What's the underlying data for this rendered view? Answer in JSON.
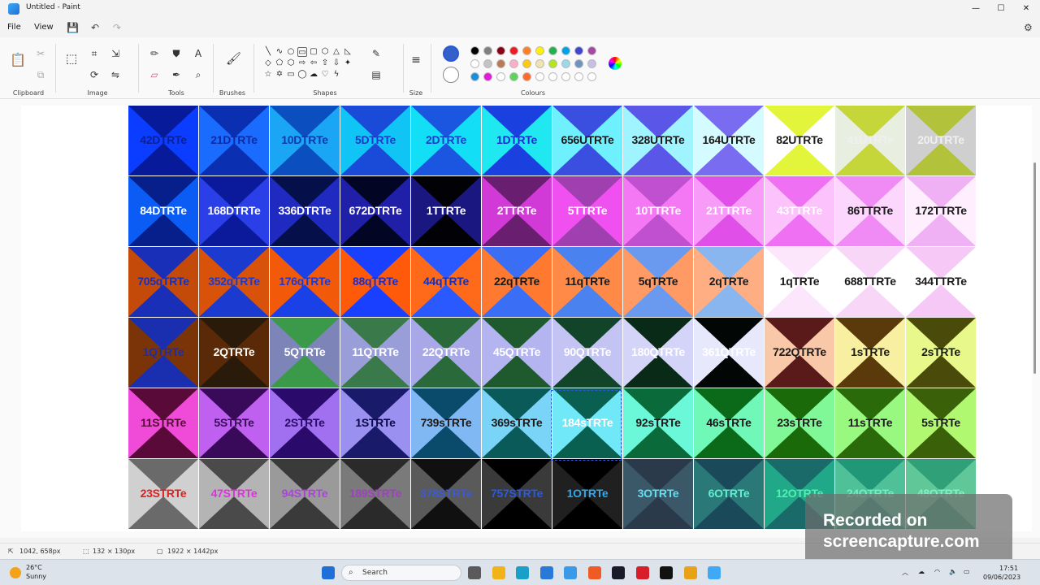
{
  "window": {
    "title": "Untitled - Paint",
    "minimize_glyph": "—",
    "maximize_glyph": "☐",
    "close_glyph": "✕"
  },
  "menu": {
    "file": "File",
    "view": "View"
  },
  "ribbon": {
    "groups": [
      "Clipboard",
      "Image",
      "Tools",
      "Brushes",
      "Shapes",
      "Size",
      "Colours"
    ],
    "primary_color": "#3461c9",
    "secondary_color": "#ffffff",
    "palette_row1": [
      "#000000",
      "#7f7f7f",
      "#880015",
      "#ed1c24",
      "#ff7f27",
      "#fff200",
      "#22b14c",
      "#00a2e8",
      "#3f48cc",
      "#a349a4"
    ],
    "palette_row2": [
      "#ffffff",
      "#c3c3c3",
      "#b97a57",
      "#ffaec9",
      "#ffc90e",
      "#efe4b0",
      "#b5e61d",
      "#99d9ea",
      "#7092be",
      "#c8bfe7"
    ],
    "palette_row3": [
      "#1a8fd8",
      "#e31ad8",
      "#ffffff",
      "#5cd45c",
      "#ff6a2a",
      "#ffffff",
      "#ffffff",
      "#ffffff",
      "#ffffff",
      "#ffffff"
    ]
  },
  "canvas": {
    "rows": [
      [
        {
          "label": "42DTRTe",
          "bg": "#0a3dff",
          "dark": "#061a9a",
          "text": "#0a1f9a"
        },
        {
          "label": "21DTRTe",
          "bg": "#1a6cff",
          "dark": "#0a2fb0",
          "text": "#0b2aa8"
        },
        {
          "label": "10DTRTe",
          "bg": "#1aa6f5",
          "dark": "#0a4ec0",
          "text": "#0b3ab0"
        },
        {
          "label": "5DTRTe",
          "bg": "#10c4f5",
          "dark": "#1a4ad8",
          "text": "#1a3cc8"
        },
        {
          "label": "2DTRTe",
          "bg": "#12dff5",
          "dark": "#1a56e0",
          "text": "#1a3ad0"
        },
        {
          "label": "1DTRTe",
          "bg": "#20e8f0",
          "dark": "#1a40e0",
          "text": "#1a2fd0"
        },
        {
          "label": "656UTRTe",
          "bg": "#6ff0ff",
          "dark": "#3a4ee0",
          "text": "#1a1a1a"
        },
        {
          "label": "328UTRTe",
          "bg": "#a0f4ff",
          "dark": "#5a56e8",
          "text": "#1a1a1a"
        },
        {
          "label": "164UTRTe",
          "bg": "#d4fbff",
          "dark": "#7a6cf0",
          "text": "#1a1a1a"
        },
        {
          "label": "82UTRTe",
          "bg": "#ffffff",
          "dark": "#e2f53a",
          "text": "#1a1a1a"
        },
        {
          "label": "41UTRTe",
          "bg": "#e8eee0",
          "dark": "#c4d63a",
          "text": "#f0f0f0"
        },
        {
          "label": "20UTRTe",
          "bg": "#cfcfcf",
          "dark": "#b2c23a",
          "text": "#f0f0f0"
        }
      ],
      [
        {
          "label": "84DTRTe",
          "bg": "#0a5cf5",
          "dark": "#061f8a",
          "text": "#ffffff"
        },
        {
          "label": "168DTRTe",
          "bg": "#2a3fe8",
          "dark": "#0a1a9a",
          "text": "#ffffff"
        },
        {
          "label": "336DTRTe",
          "bg": "#1f2ac0",
          "dark": "#05104a",
          "text": "#ffffff"
        },
        {
          "label": "672DTRTe",
          "bg": "#1f1fa8",
          "dark": "#020524",
          "text": "#ffffff"
        },
        {
          "label": "1TTRTe",
          "bg": "#1a1880",
          "dark": "#010106",
          "text": "#ffffff"
        },
        {
          "label": "2TTRTe",
          "bg": "#d23ad8",
          "dark": "#6a1e70",
          "text": "#ffffff"
        },
        {
          "label": "5TTRTe",
          "bg": "#f050f0",
          "dark": "#a040b0",
          "text": "#ffffff"
        },
        {
          "label": "10TTRTe",
          "bg": "#f478f4",
          "dark": "#c050d0",
          "text": "#ffffff"
        },
        {
          "label": "21TTRTe",
          "bg": "#f89af8",
          "dark": "#e050e8",
          "text": "#ffffff"
        },
        {
          "label": "43TTRTe",
          "bg": "#fbc2fb",
          "dark": "#f070f4",
          "text": "#ffffff"
        },
        {
          "label": "86TTRTe",
          "bg": "#fcd6fc",
          "dark": "#f08af4",
          "text": "#1a1a1a"
        },
        {
          "label": "172TTRTe",
          "bg": "#feeefe",
          "dark": "#f0b0f4",
          "text": "#1a1a1a"
        }
      ],
      [
        {
          "label": "705qTRTe",
          "bg": "#c44a0a",
          "dark": "#1a2fb8",
          "text": "#1a2fb8"
        },
        {
          "label": "352qTRTe",
          "bg": "#d8520a",
          "dark": "#1a3ad0",
          "text": "#1a3ad0"
        },
        {
          "label": "176qTRTe",
          "bg": "#f25a0a",
          "dark": "#1a40e8",
          "text": "#1a3ad8"
        },
        {
          "label": "88qTRTe",
          "bg": "#ff5a0a",
          "dark": "#1a40ff",
          "text": "#1a2fc8"
        },
        {
          "label": "44qTRTe",
          "bg": "#ff6a1a",
          "dark": "#2a5aff",
          "text": "#1a2fb0"
        },
        {
          "label": "22qTRTe",
          "bg": "#ff7a30",
          "dark": "#3a6ef5",
          "text": "#1a1a1a"
        },
        {
          "label": "11qTRTe",
          "bg": "#ff8a48",
          "dark": "#4a82f0",
          "text": "#1a1a1a"
        },
        {
          "label": "5qTRTe",
          "bg": "#ff9a64",
          "dark": "#6a9af0",
          "text": "#1a1a1a"
        },
        {
          "label": "2qTRTe",
          "bg": "#ffae84",
          "dark": "#8ab6f0",
          "text": "#1a1a1a"
        },
        {
          "label": "1qTRTe",
          "bg": "#ffffff",
          "dark": "#fbe6fb",
          "text": "#1a1a1a"
        },
        {
          "label": "688TTRTe",
          "bg": "#ffffff",
          "dark": "#f8d6f8",
          "text": "#1a1a1a"
        },
        {
          "label": "344TTRTe",
          "bg": "#ffffff",
          "dark": "#f6c8f6",
          "text": "#1a1a1a"
        }
      ],
      [
        {
          "label": "1QTRTe",
          "bg": "#7a3408",
          "dark": "#1a2fb0",
          "text": "#1a2fb0"
        },
        {
          "label": "2QTRTe",
          "bg": "#5a2a08",
          "dark": "#2a1a0a",
          "text": "#ffffff"
        },
        {
          "label": "5QTRTe",
          "bg": "#7c84b8",
          "dark": "#3a9a4a",
          "text": "#ffffff"
        },
        {
          "label": "11QTRTe",
          "bg": "#9a9ed8",
          "dark": "#3a7a4a",
          "text": "#ffffff"
        },
        {
          "label": "22QTRTe",
          "bg": "#a8a8e8",
          "dark": "#2a6a3a",
          "text": "#ffffff"
        },
        {
          "label": "45QTRTe",
          "bg": "#b4b4f0",
          "dark": "#1f5a2f",
          "text": "#ffffff"
        },
        {
          "label": "90QTRTe",
          "bg": "#c4c4f4",
          "dark": "#12442a",
          "text": "#ffffff"
        },
        {
          "label": "180QTRTe",
          "bg": "#d4d4f8",
          "dark": "#0a2a18",
          "text": "#ffffff"
        },
        {
          "label": "361QTRTe",
          "bg": "#e8e8fc",
          "dark": "#020604",
          "text": "#ffffff"
        },
        {
          "label": "722QTRTe",
          "bg": "#f8c8a8",
          "dark": "#5a1a1a",
          "text": "#1a1a1a"
        },
        {
          "label": "1sTRTe",
          "bg": "#f8f0a0",
          "dark": "#5a3a0a",
          "text": "#1a1a1a"
        },
        {
          "label": "2sTRTe",
          "bg": "#e8f88a",
          "dark": "#4a4a0a",
          "text": "#1a1a1a"
        }
      ],
      [
        {
          "label": "11STRTe",
          "bg": "#f04ad8",
          "dark": "#5a0a38",
          "text": "#5a0a38"
        },
        {
          "label": "5STRTe",
          "bg": "#c060f0",
          "dark": "#3a0a5a",
          "text": "#3a0a5a"
        },
        {
          "label": "2STRTe",
          "bg": "#a070f0",
          "dark": "#2a0a6a",
          "text": "#2a0a6a"
        },
        {
          "label": "1STRTe",
          "bg": "#9a90f0",
          "dark": "#1a1a6a",
          "text": "#0a0a4a"
        },
        {
          "label": "739sTRTe",
          "bg": "#80b8f4",
          "dark": "#0a4a6a",
          "text": "#1a1a1a"
        },
        {
          "label": "369sTRTe",
          "bg": "#7ad4f8",
          "dark": "#0a5a5a",
          "text": "#1a1a1a"
        },
        {
          "label": "184sTRTe",
          "bg": "#70e8f8",
          "dark": "#0a6050",
          "text": "#ffffff"
        },
        {
          "label": "92sTRTe",
          "bg": "#6af8d8",
          "dark": "#0a6a3a",
          "text": "#1a1a1a"
        },
        {
          "label": "46sTRTe",
          "bg": "#70f8b8",
          "dark": "#0a6a1a",
          "text": "#1a1a1a"
        },
        {
          "label": "23sTRTe",
          "bg": "#80f898",
          "dark": "#1a6a0a",
          "text": "#1a1a1a"
        },
        {
          "label": "11sTRTe",
          "bg": "#98f880",
          "dark": "#2a6a0a",
          "text": "#1a1a1a"
        },
        {
          "label": "5sTRTe",
          "bg": "#b0f870",
          "dark": "#3a600a",
          "text": "#1a1a1a"
        }
      ],
      [
        {
          "label": "23STRTe",
          "bg": "#d0d0d0",
          "dark": "#6a6a6a",
          "text": "#e02020"
        },
        {
          "label": "47STRTe",
          "bg": "#b4b4b4",
          "dark": "#4a4a4a",
          "text": "#e030e0"
        },
        {
          "label": "94STRTe",
          "bg": "#9a9a9a",
          "dark": "#3a3a3a",
          "text": "#b040e0"
        },
        {
          "label": "189STRTe",
          "bg": "#7a7a7a",
          "dark": "#2a2a2a",
          "text": "#a040c0"
        },
        {
          "label": "378STRTe",
          "bg": "#5a5a5a",
          "dark": "#101010",
          "text": "#3a5ad8"
        },
        {
          "label": "757STRTe",
          "bg": "#3a3a3a",
          "dark": "#000000",
          "text": "#2a5ae0"
        },
        {
          "label": "1OTRTe",
          "bg": "#202020",
          "dark": "#000000",
          "text": "#30a8f0"
        },
        {
          "label": "3OTRTe",
          "bg": "#3a5868",
          "dark": "#2a3a4a",
          "text": "#60e0f0"
        },
        {
          "label": "6OTRTe",
          "bg": "#2a7878",
          "dark": "#1a4a5a",
          "text": "#60f0d0"
        },
        {
          "label": "12OTRTe",
          "bg": "#20a888",
          "dark": "#1a6a6a",
          "text": "#50f0b0"
        },
        {
          "label": "24OTRTe",
          "bg": "#50c098",
          "dark": "#209878",
          "text": "#70f0c0"
        },
        {
          "label": "48OTRTe",
          "bg": "#60c898",
          "dark": "#30a078",
          "text": "#80f0c8"
        }
      ]
    ]
  },
  "status": {
    "cursor_pos": "1042, 658px",
    "selection_size": "132 × 130px",
    "image_size": "1922 × 1442px"
  },
  "watermark": {
    "line1": "Recorded on",
    "line2": "screencapture.com"
  },
  "taskbar": {
    "temperature": "26°C",
    "condition": "Sunny",
    "search_label": "Search",
    "time": "17:51",
    "date": "09/06/2023",
    "icons": [
      {
        "name": "start-icon",
        "color": "#1f6fd9"
      },
      {
        "name": "task-view-icon",
        "color": "#5a5a5a"
      },
      {
        "name": "file-explorer-icon",
        "color": "#f2b31a"
      },
      {
        "name": "edge-icon",
        "color": "#1aa0c8"
      },
      {
        "name": "store-icon",
        "color": "#2a78d8"
      },
      {
        "name": "settings-icon",
        "color": "#3a9ae8"
      },
      {
        "name": "brave-icon",
        "color": "#f05a24"
      },
      {
        "name": "adobe-icon",
        "color": "#1a1a2a"
      },
      {
        "name": "mcafee-icon",
        "color": "#d81e2a"
      },
      {
        "name": "tiktok-icon",
        "color": "#111111"
      },
      {
        "name": "chrome-icon",
        "color": "#e8a21a"
      },
      {
        "name": "paint-taskbar-icon",
        "color": "#3fa9f5"
      }
    ]
  }
}
